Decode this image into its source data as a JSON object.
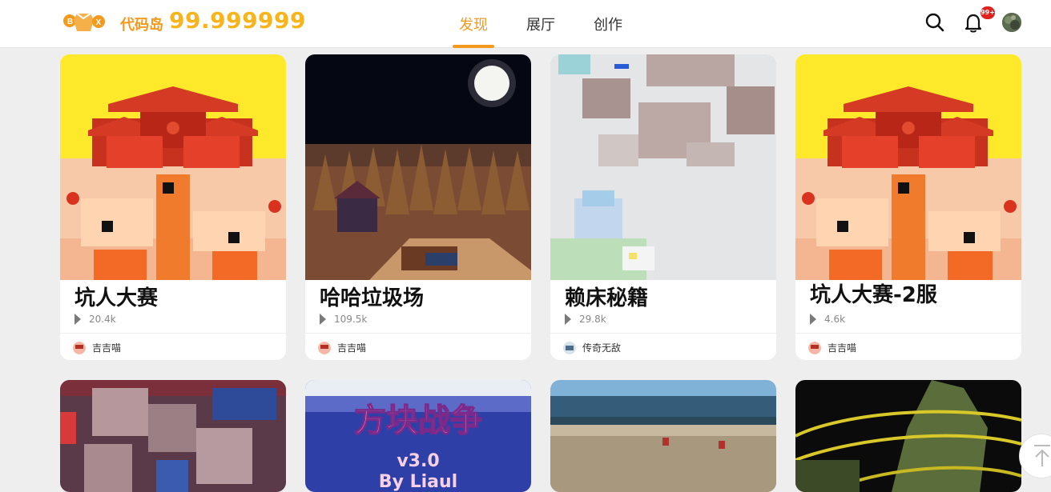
{
  "header": {
    "brand": "代码岛",
    "coins": "99.999999",
    "notification_badge": "99+",
    "nav": [
      {
        "label": "发现",
        "active": true
      },
      {
        "label": "展厅",
        "active": false
      },
      {
        "label": "创作",
        "active": false
      }
    ],
    "icons": {
      "search": "search-icon",
      "bell": "bell-icon",
      "avatar": "user-avatar"
    },
    "colors": {
      "accent": "#f39a1e",
      "coins": "#f7b41c",
      "badge": "#e0211d"
    }
  },
  "games_row1": [
    {
      "title": "坑人大赛",
      "plays": "20.4k",
      "author": "吉吉喵"
    },
    {
      "title": "哈哈垃圾场",
      "plays": "109.5k",
      "author": "吉吉喵"
    },
    {
      "title": "赖床秘籍",
      "plays": "29.8k",
      "author": "传奇无敌"
    },
    {
      "title": "坑人大赛-2服",
      "plays": "4.6k",
      "author": "吉吉喵"
    }
  ],
  "games_row2": [
    {
      "thumb_text": ""
    },
    {
      "thumb_text": "方块战争",
      "version": "v3.0",
      "byline": "By Liaul"
    },
    {
      "thumb_text": ""
    },
    {
      "thumb_text": ""
    }
  ]
}
